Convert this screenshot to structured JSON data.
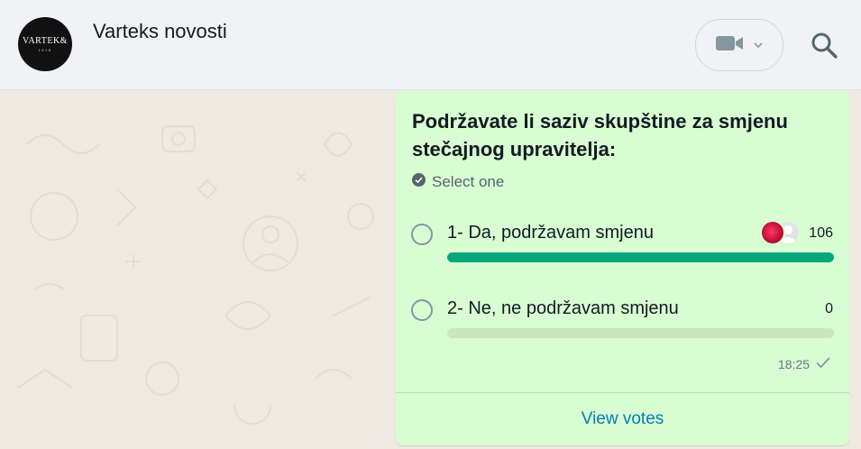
{
  "header": {
    "avatar_text": "VARTEK&",
    "avatar_subtext": "1918",
    "title": "Varteks novosti",
    "video_icon": "video-camera-icon",
    "dropdown_icon": "chevron-down-icon",
    "search_icon": "search-icon"
  },
  "poll": {
    "question": "Podržavate li saziv skupštine za smjenu stečajnog upravitelja:",
    "select_hint": "Select one",
    "options": [
      {
        "label": "1- Da, podržavam smjenu",
        "votes": "106",
        "fraction": 1.0
      },
      {
        "label": "2- Ne, ne podržavam smjenu",
        "votes": "0",
        "fraction": 0.0
      }
    ],
    "time": "18:25",
    "status_icon": "single-check-icon",
    "view_votes": "View votes"
  },
  "colors": {
    "bubble": "#d9fdd3",
    "bar_fill": "#06a77d",
    "bar_track": "#c8e6c1",
    "link": "#027eb5",
    "header_bg": "#f0f2f5",
    "wallpaper": "#efeae2"
  }
}
